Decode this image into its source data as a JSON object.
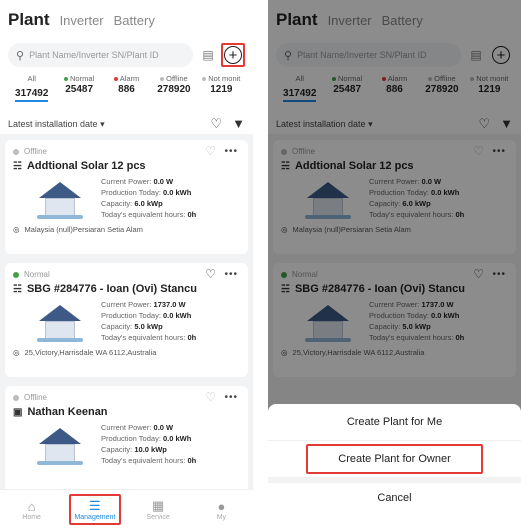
{
  "tabs": {
    "active": "Plant",
    "inverter": "Inverter",
    "battery": "Battery"
  },
  "search": {
    "placeholder": "Plant Name/Inverter SN/Plant ID"
  },
  "stats": [
    {
      "label": "All",
      "value": "317492",
      "color": ""
    },
    {
      "label": "Normal",
      "value": "25487",
      "color": "#43a047"
    },
    {
      "label": "Alarm",
      "value": "886",
      "color": "#e53935"
    },
    {
      "label": "Offline",
      "value": "278920",
      "color": "#bbbbbb"
    },
    {
      "label": "Not monit",
      "value": "1219",
      "color": "#bbbbbb"
    }
  ],
  "sort": {
    "label": "Latest installation date",
    "chevron_icon": "caret-down-icon"
  },
  "plants": [
    {
      "status": "Offline",
      "status_color": "#bbbbbb",
      "name": "Addtional Solar 12 pcs",
      "current_power_label": "Current Power:",
      "current_power": "0.0 W",
      "production_label": "Production Today:",
      "production": "0.0 kWh",
      "capacity_label": "Capacity:",
      "capacity": "6.0 kWp",
      "hours_label": "Today's equivalent hours:",
      "hours": "0h",
      "location": "Malaysia (null)Persiaran Setia Alam"
    },
    {
      "status": "Normal",
      "status_color": "#43a047",
      "name": "SBG #284776 - Ioan (Ovi) Stancu",
      "current_power_label": "Current Power:",
      "current_power": "1737.0 W",
      "production_label": "Production Today:",
      "production": "0.0 kWh",
      "capacity_label": "Capacity:",
      "capacity": "5.0 kWp",
      "hours_label": "Today's equivalent hours:",
      "hours": "0h",
      "location": "25,Victory,Harrisdale WA 6112,Australia"
    },
    {
      "status": "Offline",
      "status_color": "#bbbbbb",
      "name": "Nathan Keenan",
      "current_power_label": "Current Power:",
      "current_power": "0.0 W",
      "production_label": "Production Today:",
      "production": "0.0 kWh",
      "capacity_label": "Capacity:",
      "capacity": "10.0 kWp",
      "hours_label": "Today's equivalent hours:",
      "hours": "0h",
      "location": ""
    }
  ],
  "nav": [
    {
      "label": "Home",
      "icon": "home-icon"
    },
    {
      "label": "Management",
      "icon": "list-icon"
    },
    {
      "label": "Service",
      "icon": "grid-icon"
    },
    {
      "label": "My",
      "icon": "user-icon"
    }
  ],
  "sheet": {
    "create_for_me": "Create Plant for Me",
    "create_for_owner": "Create Plant for Owner",
    "cancel": "Cancel"
  },
  "colors": {
    "accent": "#1e88e5",
    "highlight": "#e53935"
  }
}
